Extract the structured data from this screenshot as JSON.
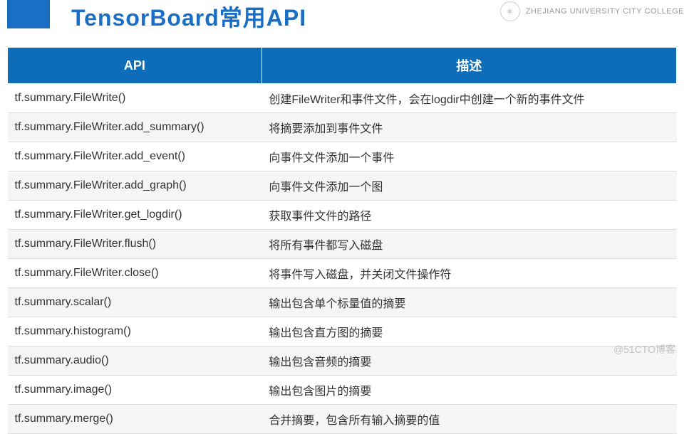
{
  "header": {
    "title": "TensorBoard常用API",
    "rightText": "ZHEJIANG UNIVERSITY CITY COLLEGE"
  },
  "table": {
    "headers": {
      "api": "API",
      "desc": "描述"
    },
    "rows": [
      {
        "api": "tf.summary.FileWrite()",
        "desc": "创建FileWriter和事件文件，会在logdir中创建一个新的事件文件"
      },
      {
        "api": "tf.summary.FileWriter.add_summary()",
        "desc": "将摘要添加到事件文件"
      },
      {
        "api": "tf.summary.FileWriter.add_event()",
        "desc": "向事件文件添加一个事件"
      },
      {
        "api": "tf.summary.FileWriter.add_graph()",
        "desc": "向事件文件添加一个图"
      },
      {
        "api": "tf.summary.FileWriter.get_logdir()",
        "desc": "获取事件文件的路径"
      },
      {
        "api": "tf.summary.FileWriter.flush()",
        "desc": "将所有事件都写入磁盘"
      },
      {
        "api": "tf.summary.FileWriter.close()",
        "desc": "将事件写入磁盘，并关闭文件操作符"
      },
      {
        "api": "tf.summary.scalar()",
        "desc": "输出包含单个标量值的摘要"
      },
      {
        "api": "tf.summary.histogram()",
        "desc": "输出包含直方图的摘要"
      },
      {
        "api": "tf.summary.audio()",
        "desc": "输出包含音频的摘要"
      },
      {
        "api": "tf.summary.image()",
        "desc": "输出包含图片的摘要"
      },
      {
        "api": "tf.summary.merge()",
        "desc": "合并摘要，包含所有输入摘要的值"
      }
    ]
  },
  "watermark": "@51CTO博客"
}
